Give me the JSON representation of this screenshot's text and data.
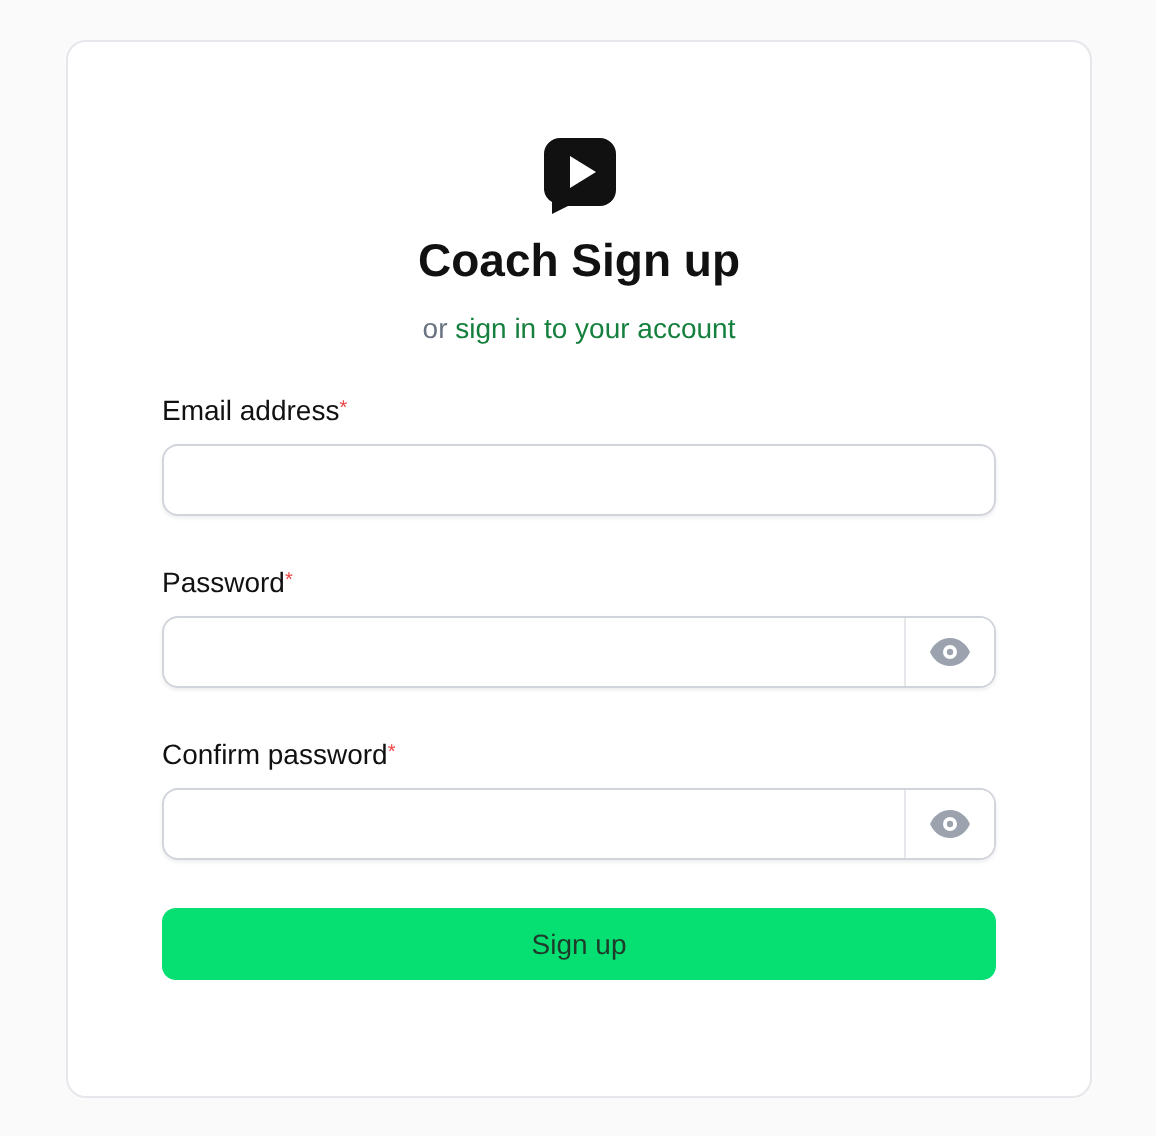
{
  "title": "Coach Sign up",
  "subtitle": {
    "prefix": "or",
    "link": "sign in to your account"
  },
  "fields": [
    {
      "label": "Email address",
      "required_mark": "*",
      "kind": "email"
    },
    {
      "label": "Password",
      "required_mark": "*",
      "kind": "password"
    },
    {
      "label": "Confirm password",
      "required_mark": "*",
      "kind": "password"
    }
  ],
  "submit": "Sign up"
}
